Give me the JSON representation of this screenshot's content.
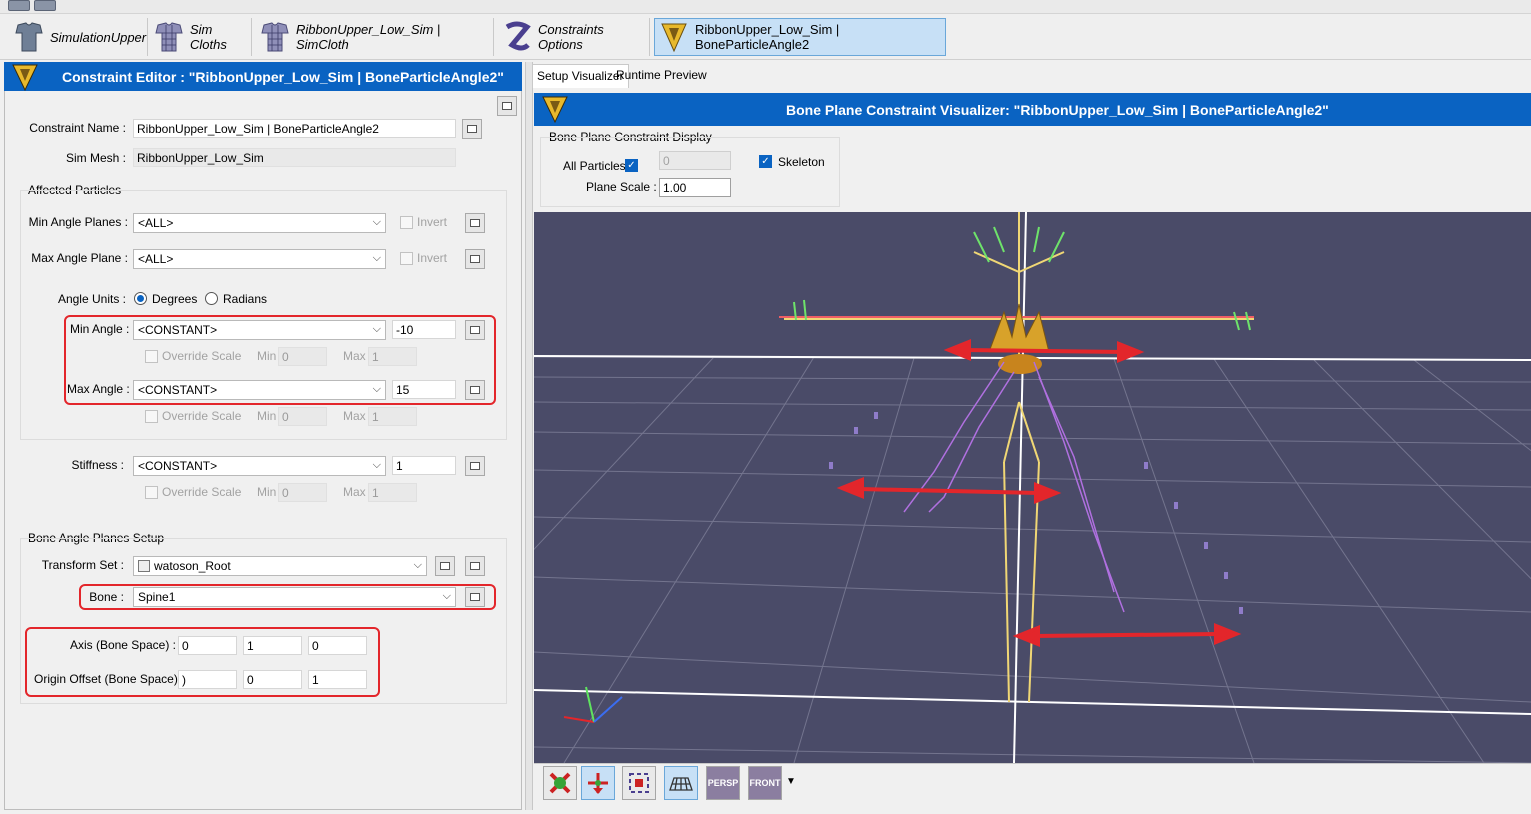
{
  "tabs": [
    {
      "label": "SimulationUpper",
      "icon": "tshirt-icon"
    },
    {
      "label": "Sim Cloths",
      "icon": "cloth-mesh-icon"
    },
    {
      "label": "RibbonUpper_Low_Sim | SimCloth",
      "icon": "cloth-mesh-icon"
    },
    {
      "label": "Constraints Options",
      "icon": "constraint-z-icon"
    },
    {
      "label": "RibbonUpper_Low_Sim | BoneParticleAngle2",
      "icon": "v-logo-icon"
    }
  ],
  "constraint_editor": {
    "title": "Constraint Editor : \"RibbonUpper_Low_Sim | BoneParticleAngle2\"",
    "constraint_name_label": "Constraint Name :",
    "constraint_name_value": "RibbonUpper_Low_Sim | BoneParticleAngle2",
    "sim_mesh_label": "Sim Mesh :",
    "sim_mesh_value": "RibbonUpper_Low_Sim",
    "affected_particles": {
      "group_label": "Affected Particles",
      "min_angle_planes_label": "Min Angle Planes :",
      "min_angle_planes_value": "<ALL>",
      "max_angle_plane_label": "Max Angle Plane :",
      "max_angle_plane_value": "<ALL>",
      "invert_label": "Invert",
      "angle_units_label": "Angle Units :",
      "degrees_label": "Degrees",
      "radians_label": "Radians",
      "min_angle_label": "Min Angle :",
      "min_angle_mode": "<CONSTANT>",
      "min_angle_value": "-10",
      "max_angle_label": "Max Angle :",
      "max_angle_mode": "<CONSTANT>",
      "max_angle_value": "15",
      "override_scale_label": "Override Scale",
      "min_label": "Min",
      "max_label": "Max",
      "scale_min_value": "0",
      "scale_max_value": "1"
    },
    "stiffness_label": "Stiffness :",
    "stiffness_mode": "<CONSTANT>",
    "stiffness_value": "1",
    "bone_setup": {
      "group_label": "Bone Angle Planes Setup",
      "transform_set_label": "Transform Set :",
      "transform_set_value": "watoson_Root",
      "bone_label": "Bone :",
      "bone_value": "Spine1",
      "axis_label": "Axis (Bone Space) :",
      "axis_values": [
        "0",
        "1",
        "0"
      ],
      "origin_offset_label": "Origin Offset (Bone Space) :",
      "origin_offset_values": [
        ")",
        "0",
        "1"
      ]
    }
  },
  "right_panel": {
    "subtabs": [
      "Setup Visualizer",
      "Runtime Preview"
    ],
    "title": "Bone Plane Constraint Visualizer: \"RibbonUpper_Low_Sim | BoneParticleAngle2\"",
    "display_group_label": "Bone Plane Constraint Display",
    "all_particles_label": "All Particles",
    "all_particles_checked": true,
    "particle_index_value": "0",
    "skeleton_label": "Skeleton",
    "skeleton_checked": true,
    "plane_scale_label": "Plane Scale :",
    "plane_scale_value": "1.00",
    "viewport_toolbar": [
      {
        "name": "reset-view-icon",
        "label": ""
      },
      {
        "name": "move-arrows-icon",
        "label": ""
      },
      {
        "name": "frame-selection-icon",
        "label": ""
      },
      {
        "name": "grid-icon",
        "label": ""
      },
      {
        "name": "persp-view-icon",
        "label": "PERSP"
      },
      {
        "name": "front-view-icon",
        "label": "FRONT"
      }
    ]
  },
  "colors": {
    "header_blue": "#0a63c2",
    "annotation_red": "#e3262b",
    "viewport_bg": "#4a4b68",
    "active_tab": "#c7e0f6"
  }
}
